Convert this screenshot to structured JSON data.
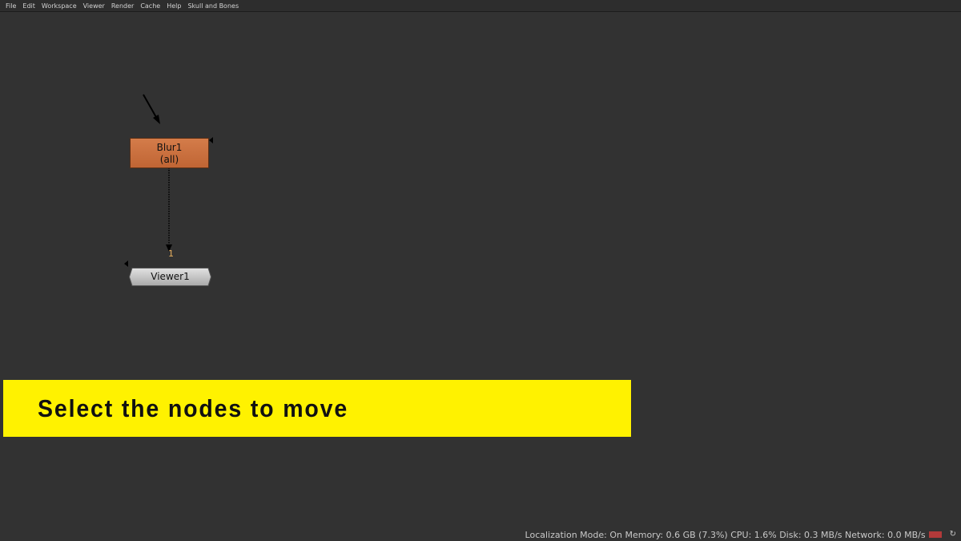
{
  "menubar": {
    "items": [
      {
        "label": "File"
      },
      {
        "label": "Edit"
      },
      {
        "label": "Workspace"
      },
      {
        "label": "Viewer"
      },
      {
        "label": "Render"
      },
      {
        "label": "Cache"
      },
      {
        "label": "Help"
      },
      {
        "label": "Skull and Bones"
      }
    ]
  },
  "nodes": {
    "blur": {
      "name": "Blur1",
      "channels": "(all)",
      "color": "#c96d3c"
    },
    "viewer": {
      "name": "Viewer1",
      "input_number": "1",
      "color": "#c8c8c8"
    }
  },
  "caption": {
    "text": "Select the nodes to move",
    "background": "#fff200"
  },
  "statusbar": {
    "text": "Localization Mode: On Memory: 0.6 GB (7.3%) CPU: 1.6% Disk: 0.3 MB/s Network: 0.0 MB/s",
    "memory_indicator_color": "#b23a3a",
    "refresh_icon": "refresh-icon"
  }
}
